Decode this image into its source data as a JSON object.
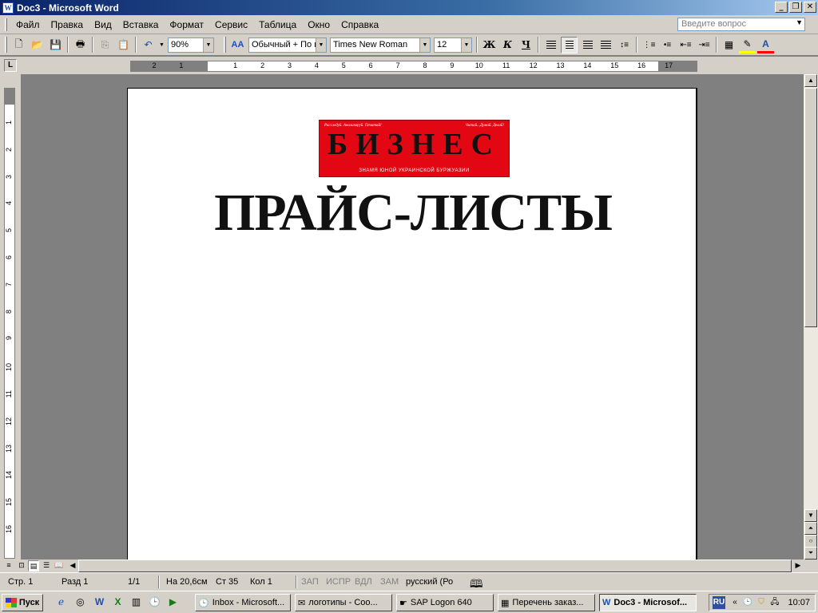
{
  "window": {
    "title": "Doc3 - Microsoft Word",
    "min": "_",
    "restore": "❐",
    "close": "✕"
  },
  "menu": {
    "items": [
      {
        "label": "Файл",
        "key": "file"
      },
      {
        "label": "Правка",
        "key": "edit"
      },
      {
        "label": "Вид",
        "key": "view"
      },
      {
        "label": "Вставка",
        "key": "insert"
      },
      {
        "label": "Формат",
        "key": "format"
      },
      {
        "label": "Сервис",
        "key": "tools"
      },
      {
        "label": "Таблица",
        "key": "table"
      },
      {
        "label": "Окно",
        "key": "window"
      },
      {
        "label": "Справка",
        "key": "help"
      }
    ],
    "help_placeholder": "Введите вопрос"
  },
  "toolbar": {
    "zoom": "90%",
    "style": "Обычный + По ц",
    "font": "Times New Roman",
    "size": "12",
    "bold": "Ж",
    "italic": "К",
    "underline": "Ч",
    "aa": "AA",
    "highlight_color": "#ffff00",
    "font_color": "#ff0000"
  },
  "ruler": {
    "h_numbers": [
      "2",
      "1",
      "",
      "1",
      "2",
      "3",
      "4",
      "5",
      "6",
      "7",
      "8",
      "9",
      "10",
      "11",
      "12",
      "13",
      "14",
      "15",
      "16",
      "17"
    ],
    "v_numbers": [
      "1",
      "2",
      "3",
      "4",
      "5",
      "6",
      "7",
      "8",
      "9",
      "10",
      "11",
      "12",
      "13",
      "14",
      "15",
      "16"
    ]
  },
  "document": {
    "logo": {
      "title": "БИЗНЕС",
      "tagline_left": "Расследуй. Анализируй. Печатай!",
      "tagline_right": "Читай...Думай. Делай!",
      "subtitle": "ЗНАМЯ ЮНОЙ УКРАИНСКОЙ БУРЖУАЗИИ",
      "color": "#e30613"
    },
    "heading": "ПРАЙС-ЛИСТЫ"
  },
  "status": {
    "page": "Стр.  1",
    "section": "Разд  1",
    "pages": "1/1",
    "at": "На 20,6см",
    "line": "Ст  35",
    "col": "Кол  1",
    "rec": "ЗАП",
    "trk": "ИСПР",
    "ext": "ВДЛ",
    "ovr": "ЗАМ",
    "lang": "русский (Ро"
  },
  "taskbar": {
    "start": "Пуск",
    "tasks": [
      {
        "label": "Inbox - Microsoft...",
        "icon": "🕒"
      },
      {
        "label": "логотипы - Соо...",
        "icon": "✉"
      },
      {
        "label": "SAP Logon 640",
        "icon": "☛"
      },
      {
        "label": "Перечень заказ...",
        "icon": "▦"
      },
      {
        "label": "Doc3 - Microsof...",
        "icon": "W"
      }
    ],
    "lang": "RU",
    "expand": "«",
    "clock": "10:07"
  }
}
